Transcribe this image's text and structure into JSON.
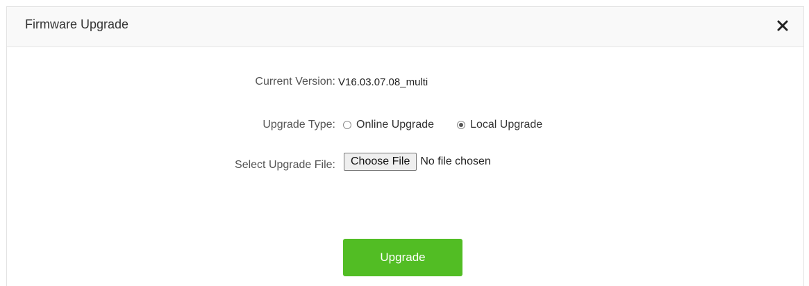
{
  "dialog": {
    "title": "Firmware Upgrade",
    "close_icon": "close-icon"
  },
  "current_version": {
    "label": "Current Version:",
    "value": "V16.03.07.08_multi"
  },
  "upgrade_type": {
    "label": "Upgrade Type:",
    "options": [
      {
        "label": "Online Upgrade",
        "selected": false
      },
      {
        "label": "Local Upgrade",
        "selected": true
      }
    ]
  },
  "upgrade_file": {
    "label": "Select Upgrade File:",
    "button_label": "Choose File",
    "status": "No file chosen"
  },
  "actions": {
    "upgrade_label": "Upgrade"
  },
  "colors": {
    "primary_button": "#52bd24"
  }
}
